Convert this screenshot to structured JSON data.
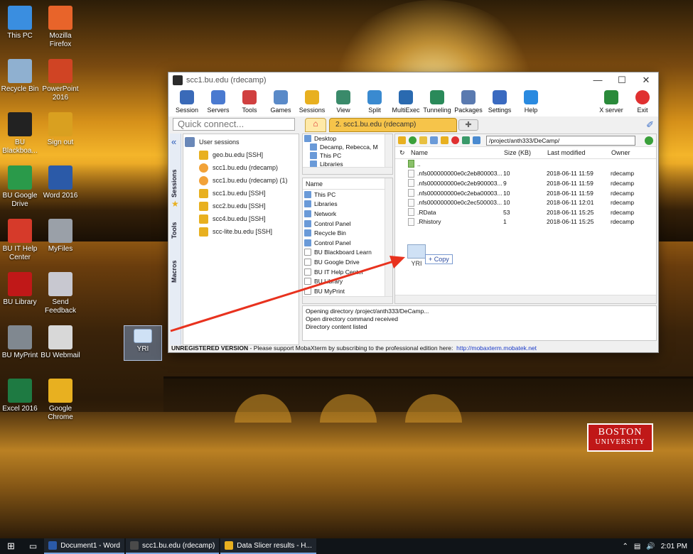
{
  "desktop": {
    "icons": [
      {
        "label": "This PC",
        "icon": "this-pc-icon",
        "color": "#3a8ee0"
      },
      {
        "label": "Mozilla Firefox",
        "icon": "firefox-icon",
        "color": "#e8642a"
      },
      {
        "label": "Recycle Bin",
        "icon": "recycle-bin-icon",
        "color": "#8fb0d0"
      },
      {
        "label": "PowerPoint 2016",
        "icon": "powerpoint-icon",
        "color": "#d04424"
      },
      {
        "label": "BU Blackboa...",
        "icon": "blackboard-icon",
        "color": "#222222"
      },
      {
        "label": "Sign out",
        "icon": "sign-out-icon",
        "color": "#d9a020"
      },
      {
        "label": "BU Google Drive",
        "icon": "google-drive-icon",
        "color": "#2a9a4a"
      },
      {
        "label": "Word 2016",
        "icon": "word-icon",
        "color": "#2b5aa8"
      },
      {
        "label": "BU IT Help Center",
        "icon": "help-center-icon",
        "color": "#d63a2a"
      },
      {
        "label": "MyFiles",
        "icon": "myfiles-icon",
        "color": "#9aa0a8"
      },
      {
        "label": "BU Library",
        "icon": "bu-library-icon",
        "color": "#c01818"
      },
      {
        "label": "Send Feedback",
        "icon": "send-feedback-icon",
        "color": "#c8c8d0"
      },
      {
        "label": "BU MyPrint",
        "icon": "myprint-icon",
        "color": "#808890"
      },
      {
        "label": "BU Webmail",
        "icon": "webmail-icon",
        "color": "#d8d8d8"
      },
      {
        "label": "Excel 2016",
        "icon": "excel-icon",
        "color": "#1e7a42"
      },
      {
        "label": "Google Chrome",
        "icon": "chrome-icon",
        "color": "#e8b020"
      }
    ],
    "dragged_file": {
      "label": "YRI"
    },
    "brand": {
      "line1": "BOSTON",
      "line2": "UNIVERSITY"
    }
  },
  "window": {
    "title": "scc1.bu.edu (rdecamp)",
    "toolbar": [
      {
        "label": "Session",
        "icon": "session-icon",
        "color": "#3a6ab8"
      },
      {
        "label": "Servers",
        "icon": "servers-icon",
        "color": "#4a7ad0"
      },
      {
        "label": "Tools",
        "icon": "tools-icon",
        "color": "#d04040"
      },
      {
        "label": "Games",
        "icon": "games-icon",
        "color": "#5a8ac8"
      },
      {
        "label": "Sessions",
        "icon": "star-icon",
        "color": "#e8b020"
      },
      {
        "label": "View",
        "icon": "view-icon",
        "color": "#3a8a6a"
      },
      {
        "label": "Split",
        "icon": "split-icon",
        "color": "#3a8ad0"
      },
      {
        "label": "MultiExec",
        "icon": "multiexec-icon",
        "color": "#2a6ab0"
      },
      {
        "label": "Tunneling",
        "icon": "tunneling-icon",
        "color": "#2a8a5a"
      },
      {
        "label": "Packages",
        "icon": "packages-icon",
        "color": "#5a7ab0"
      },
      {
        "label": "Settings",
        "icon": "settings-icon",
        "color": "#3a6ac0"
      },
      {
        "label": "Help",
        "icon": "help-icon",
        "color": "#2a8ae0"
      }
    ],
    "toolbar_right": [
      {
        "label": "X server",
        "icon": "x-server-icon",
        "color": "#2a8a3a"
      },
      {
        "label": "Exit",
        "icon": "exit-icon",
        "color": "#e03030"
      }
    ],
    "quick_connect_placeholder": "Quick connect...",
    "session_tab": "2. scc1.bu.edu (rdecamp)",
    "rail": {
      "sessions": "Sessions",
      "tools": "Tools",
      "macros": "Macros"
    },
    "sessions_header": "User sessions",
    "sessions": [
      {
        "label": "geo.bu.edu [SSH]",
        "kind": "ssh"
      },
      {
        "label": "scc1.bu.edu (rdecamp)",
        "kind": "active"
      },
      {
        "label": "scc1.bu.edu (rdecamp) (1)",
        "kind": "active"
      },
      {
        "label": "scc1.bu.edu [SSH]",
        "kind": "ssh"
      },
      {
        "label": "scc2.bu.edu [SSH]",
        "kind": "ssh"
      },
      {
        "label": "scc4.bu.edu [SSH]",
        "kind": "ssh"
      },
      {
        "label": "scc-lite.bu.edu [SSH]",
        "kind": "ssh"
      }
    ],
    "tree_top": [
      "Desktop",
      "Decamp, Rebecca, M",
      "This PC",
      "Libraries"
    ],
    "tree_bottom_header": "Name",
    "tree_bottom": [
      "This PC",
      "Libraries",
      "Network",
      "Control Panel",
      "Recycle Bin",
      "Control Panel",
      "BU Blackboard Learn",
      "BU Google Drive",
      "BU IT Help Center",
      "BU Library",
      "BU MyPrint"
    ],
    "path": "/project/anth333/DeCamp/",
    "columns": {
      "name": "Name",
      "size": "Size (KB)",
      "modified": "Last modified",
      "owner": "Owner"
    },
    "parent_dir": "..",
    "files": [
      {
        "name": ".nfs000000000e0c2eb800003...",
        "size": "10",
        "modified": "2018-06-11 11:59",
        "owner": "rdecamp"
      },
      {
        "name": ".nfs000000000e0c2eb900003...",
        "size": "9",
        "modified": "2018-06-11 11:59",
        "owner": "rdecamp"
      },
      {
        "name": ".nfs000000000e0c2eba00003...",
        "size": "10",
        "modified": "2018-06-11 11:59",
        "owner": "rdecamp"
      },
      {
        "name": ".nfs000000000e0c2ec500003...",
        "size": "10",
        "modified": "2018-06-11 12:01",
        "owner": "rdecamp"
      },
      {
        "name": ".RData",
        "size": "53",
        "modified": "2018-06-11 15:25",
        "owner": "rdecamp"
      },
      {
        "name": ".Rhistory",
        "size": "1",
        "modified": "2018-06-11 15:25",
        "owner": "rdecamp"
      }
    ],
    "drag_label": "YRI",
    "copy_tip": "+ Copy",
    "log": [
      "Opening directory /project/anth333/DeCamp...",
      "Open directory command received",
      "Directory content listed"
    ],
    "status_bold": "UNREGISTERED VERSION",
    "status_text": "  -  Please support MobaXterm by subscribing to the professional edition here:",
    "status_link": "http://mobaxterm.mobatek.net"
  },
  "taskbar": {
    "items": [
      {
        "label": "Document1 - Word",
        "icon": "word-icon",
        "color": "#2b5aa8"
      },
      {
        "label": "scc1.bu.edu (rdecamp)",
        "icon": "mobaxterm-icon",
        "color": "#4a4a4a"
      },
      {
        "label": "Data Slicer results - H...",
        "icon": "chrome-icon",
        "color": "#e8b020"
      }
    ],
    "time": "2:01 PM"
  },
  "colors": {
    "accent_arrow": "#e8321e",
    "brand_red": "#c01818"
  }
}
